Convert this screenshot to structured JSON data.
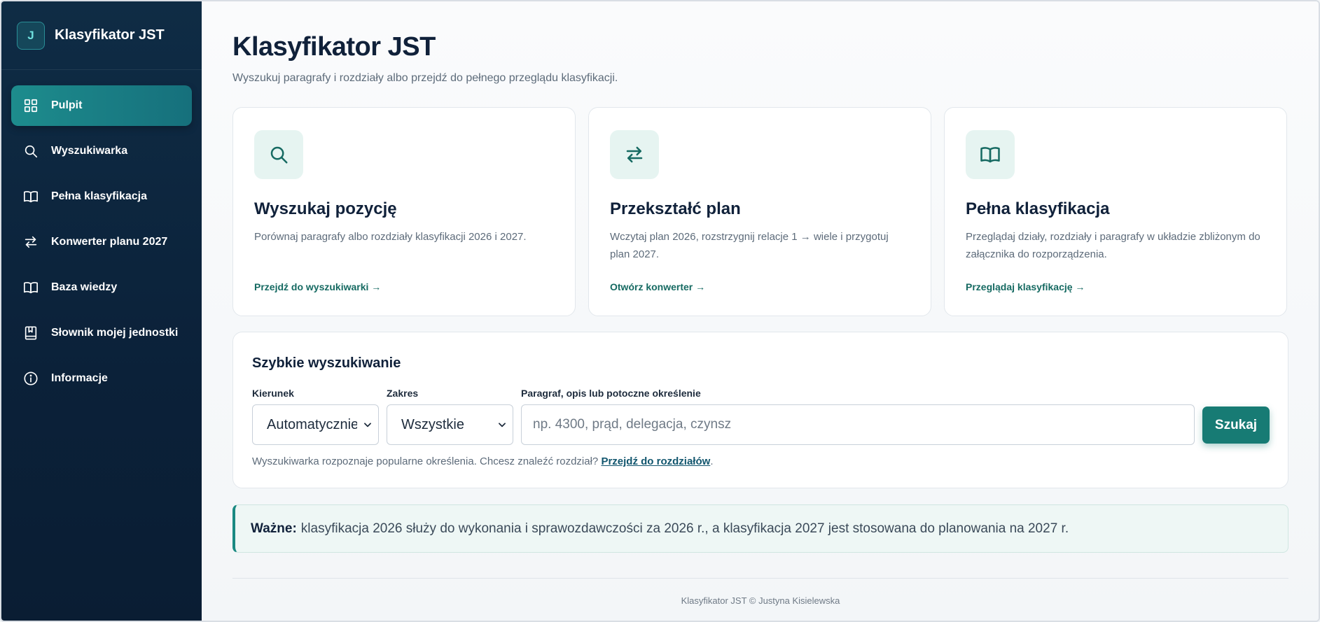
{
  "brand": {
    "logo_letter": "J",
    "name": "Klasyfikator JST"
  },
  "sidebar": {
    "items": [
      {
        "label": "Pulpit",
        "icon": "grid-icon",
        "active": true
      },
      {
        "label": "Wyszukiwarka",
        "icon": "search-icon"
      },
      {
        "label": "Pełna klasyfikacja",
        "icon": "book-icon"
      },
      {
        "label": "Konwerter planu 2027",
        "icon": "arrows-exchange-icon"
      },
      {
        "label": "Baza wiedzy",
        "icon": "book-icon"
      },
      {
        "label": "Słownik mojej jednostki",
        "icon": "bookmark-book-icon"
      },
      {
        "label": "Informacje",
        "icon": "info-icon"
      }
    ]
  },
  "main": {
    "title": "Klasyfikator JST",
    "subtitle": "Wyszukuj paragrafy i rozdziały albo przejdź do pełnego przeglądu klasyfikacji."
  },
  "cards": [
    {
      "icon": "search-icon",
      "title": "Wyszukaj pozycję",
      "description": "Porównaj paragrafy albo rozdziały klasyfikacji 2026 i 2027.",
      "link": "Przejdź do wyszukiwarki →"
    },
    {
      "icon": "arrows-exchange-icon",
      "title": "Przekształć plan",
      "description": "Wczytaj plan 2026, rozstrzygnij relacje 1 → wiele i przygotuj plan 2027.",
      "link": "Otwórz konwerter →"
    },
    {
      "icon": "book-icon",
      "title": "Pełna klasyfikacja",
      "description": "Przeglądaj działy, rozdziały i paragrafy w układzie zbliżonym do załącznika do rozporządzenia.",
      "link": "Przeglądaj klasyfikację →"
    }
  ],
  "quick_search": {
    "title": "Szybkie wyszukiwanie",
    "direction_label": "Kierunek",
    "direction_value": "Automatycznie",
    "scope_label": "Zakres",
    "scope_value": "Wszystkie",
    "query_label": "Paragraf, opis lub potoczne określenie",
    "query_placeholder": "np. 4300, prąd, delegacja, czynsz",
    "button": "Szukaj",
    "hint_text": "Wyszukiwarka rozpoznaje popularne określenia. Chcesz znaleźć rozdział?",
    "hint_link": "Przejdź do rozdziałów",
    "hint_end": "."
  },
  "note": {
    "strong": "Ważne:",
    "text": "klasyfikacja 2026 służy do wykonania i sprawozdawczości za 2026 r., a klasyfikacja 2027 jest stosowana do planowania na 2027 r."
  },
  "footer": "Klasyfikator JST © Justyna Kisielewska",
  "colors": {
    "accent": "#177b74",
    "sidebar_bg": "#0b2139",
    "link": "#166a62"
  }
}
